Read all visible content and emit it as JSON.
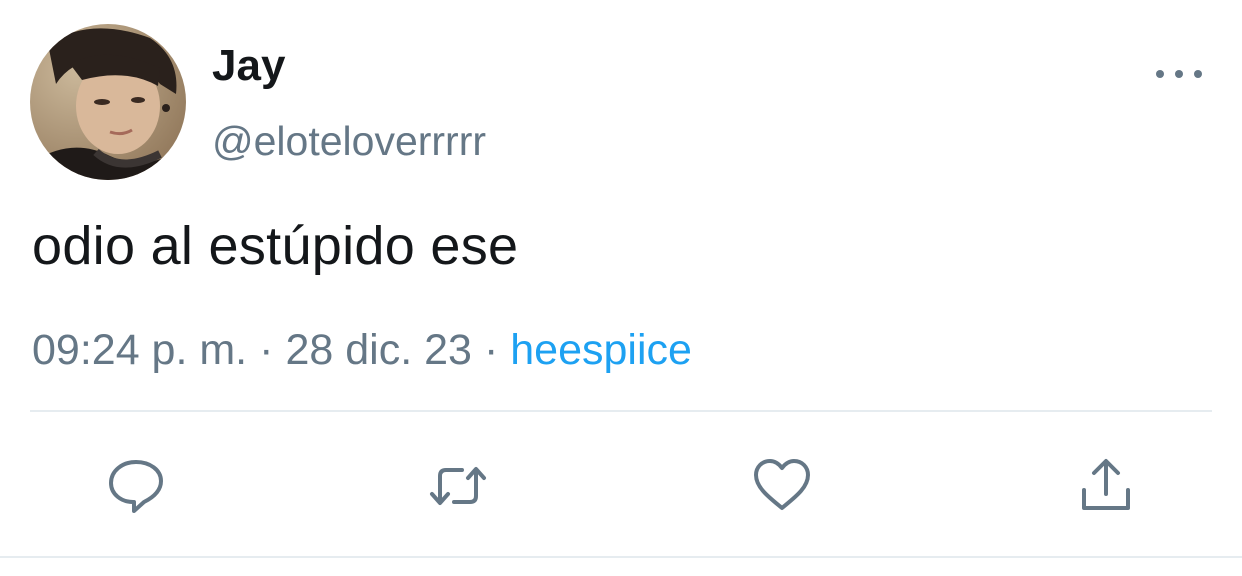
{
  "tweet": {
    "display_name": "Jay",
    "handle": "@eloteloverrrrr",
    "text": "odio al estúpido ese",
    "time": "09:24 p. m.",
    "separator": "·",
    "date": "28 dic. 23",
    "source": "heespiice"
  },
  "colors": {
    "text": "#14171a",
    "secondary": "#657786",
    "link": "#1da1f2",
    "divider": "#e6ecf0"
  },
  "actions": [
    {
      "name": "reply",
      "icon": "reply-icon"
    },
    {
      "name": "retweet",
      "icon": "retweet-icon"
    },
    {
      "name": "like",
      "icon": "heart-icon"
    },
    {
      "name": "share",
      "icon": "share-icon"
    }
  ],
  "header": {
    "more_icon": "more-options-icon"
  }
}
